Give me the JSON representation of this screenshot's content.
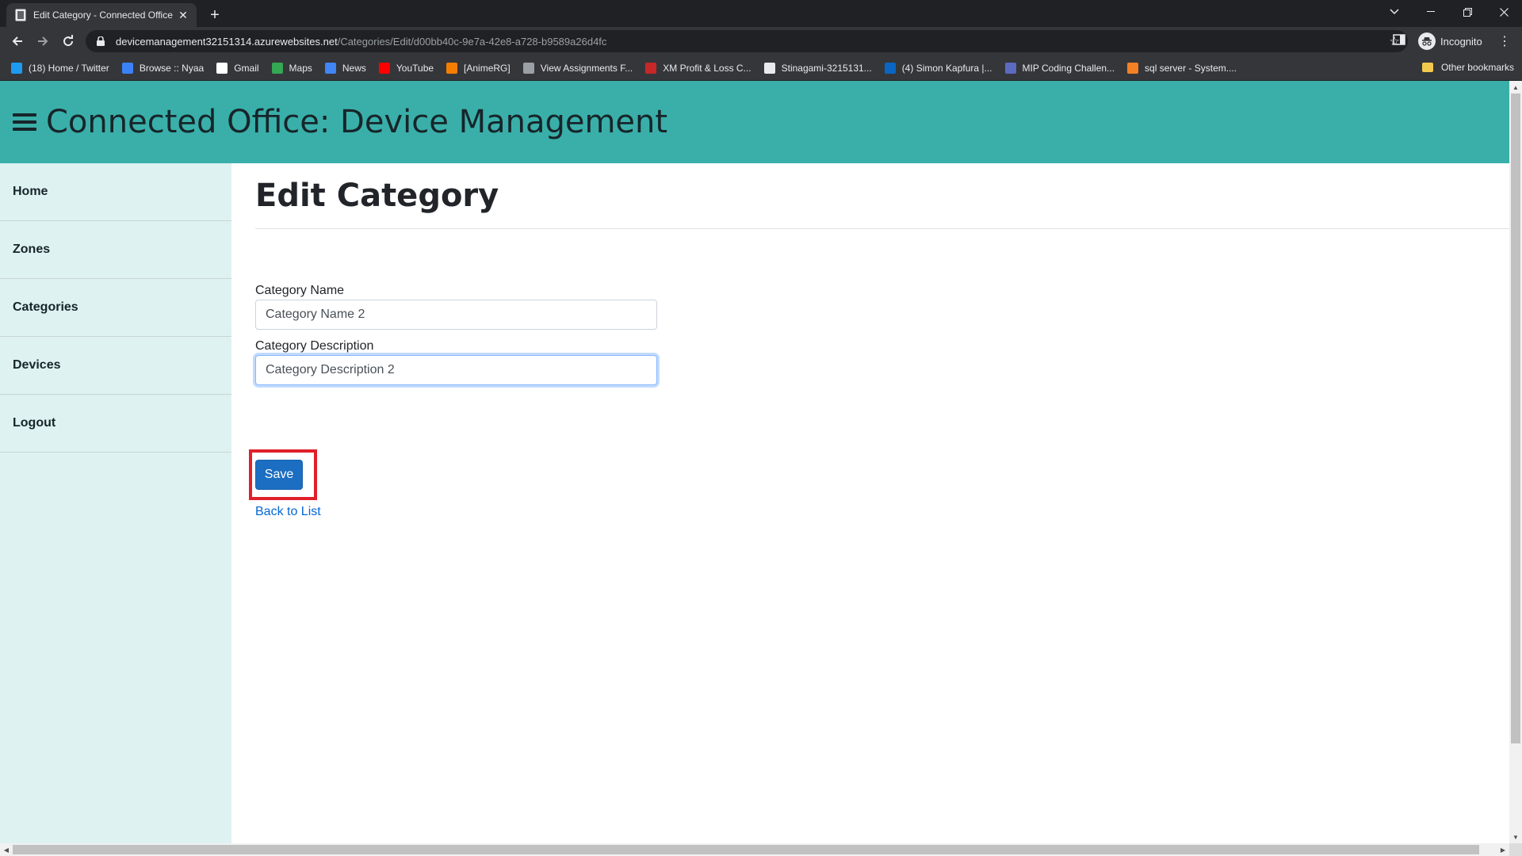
{
  "browser": {
    "tab_title": "Edit Category - Connected Office",
    "url_host": "devicemanagement32151314.azurewebsites.net",
    "url_path": "/Categories/Edit/d00bb40c-9e7a-42e8-a728-b9589a26d4fc",
    "profile_label": "Incognito",
    "bookmarks": [
      {
        "label": "(18) Home / Twitter",
        "icon": "twitter-icon",
        "color": "#1d9bf0"
      },
      {
        "label": "Browse :: Nyaa",
        "icon": "nyaa-icon",
        "color": "#3b82f6"
      },
      {
        "label": "Gmail",
        "icon": "google-icon",
        "color": "#ffffff"
      },
      {
        "label": "Maps",
        "icon": "maps-icon",
        "color": "#34a853"
      },
      {
        "label": "News",
        "icon": "news-icon",
        "color": "#4285f4"
      },
      {
        "label": "YouTube",
        "icon": "youtube-icon",
        "color": "#ff0000"
      },
      {
        "label": "[AnimeRG]",
        "icon": "blogger-icon",
        "color": "#f57d00"
      },
      {
        "label": "View Assignments F...",
        "icon": "globe-icon",
        "color": "#9aa0a6"
      },
      {
        "label": "XM Profit & Loss C...",
        "icon": "xm-icon",
        "color": "#c62828"
      },
      {
        "label": "Stinagami-3215131...",
        "icon": "github-icon",
        "color": "#e8eaed"
      },
      {
        "label": "(4) Simon Kapfura |...",
        "icon": "linkedin-icon",
        "color": "#0a66c2"
      },
      {
        "label": "MIP Coding Challen...",
        "icon": "mip-icon",
        "color": "#5c6bc0"
      },
      {
        "label": "sql server - System....",
        "icon": "stackoverflow-icon",
        "color": "#f48024"
      }
    ],
    "other_bookmarks": "Other bookmarks"
  },
  "app": {
    "title": "Connected Office: Device Management",
    "header_color": "#3aafa9",
    "sidebar_color": "#def2f1"
  },
  "sidebar": {
    "items": [
      {
        "label": "Home"
      },
      {
        "label": "Zones"
      },
      {
        "label": "Categories"
      },
      {
        "label": "Devices"
      },
      {
        "label": "Logout"
      }
    ]
  },
  "form": {
    "page_title": "Edit Category",
    "name_label": "Category Name",
    "name_value": "Category Name 2",
    "description_label": "Category Description",
    "description_value": "Category Description 2",
    "save_label": "Save",
    "back_label": "Back to List",
    "accent_color": "#1b6ec2",
    "highlight_color": "#e0202a"
  }
}
